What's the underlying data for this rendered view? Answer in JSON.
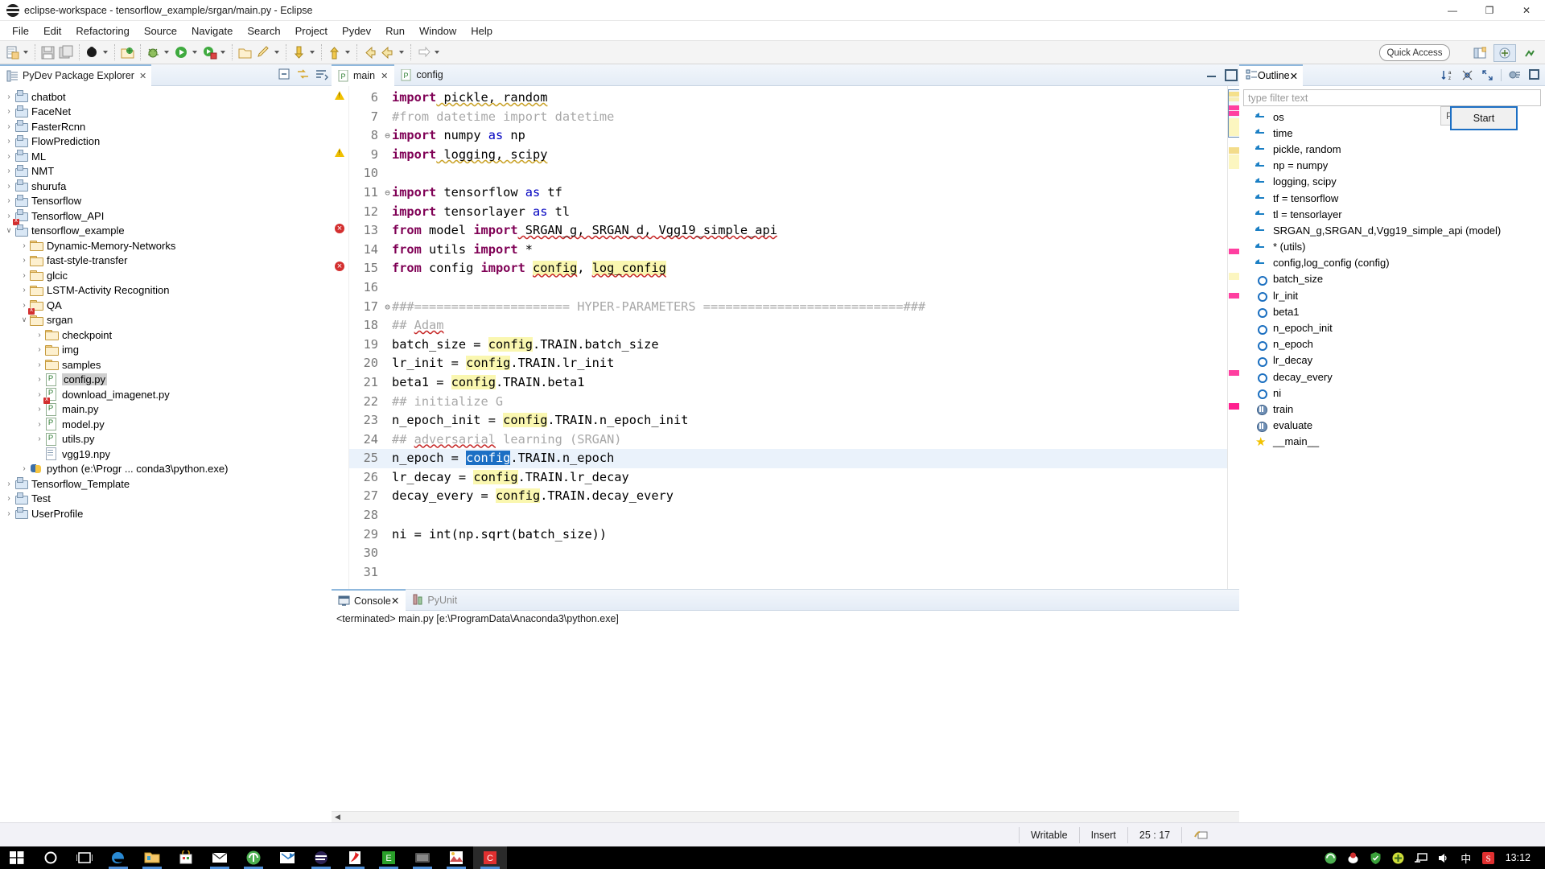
{
  "window": {
    "title": "eclipse-workspace - tensorflow_example/srgan/main.py - Eclipse",
    "minimize": "—",
    "maximize": "❐",
    "close": "✕"
  },
  "menubar": {
    "items": [
      "File",
      "Edit",
      "Refactoring",
      "Source",
      "Navigate",
      "Search",
      "Project",
      "Pydev",
      "Run",
      "Window",
      "Help"
    ]
  },
  "toolbar": {
    "quick_access": "Quick Access",
    "perspective_poi": "Poi...",
    "start_tooltip": "Start"
  },
  "package_explorer": {
    "tab_label": "PyDev Package Explorer",
    "tab_close": "✕",
    "tools": [
      "collapse-all-icon",
      "link-with-editor-icon",
      "view-menu-icon"
    ],
    "tree": [
      {
        "label": "chatbot",
        "indent": 0,
        "icon": "project-icon",
        "twist": "›"
      },
      {
        "label": "FaceNet",
        "indent": 0,
        "icon": "project-icon",
        "twist": "›"
      },
      {
        "label": "FasterRcnn",
        "indent": 0,
        "icon": "project-icon",
        "twist": "›"
      },
      {
        "label": "FlowPrediction",
        "indent": 0,
        "icon": "project-icon",
        "twist": "›"
      },
      {
        "label": "ML",
        "indent": 0,
        "icon": "project-icon",
        "twist": "›"
      },
      {
        "label": "NMT",
        "indent": 0,
        "icon": "project-icon",
        "twist": "›"
      },
      {
        "label": "shurufa",
        "indent": 0,
        "icon": "project-icon",
        "twist": "›"
      },
      {
        "label": "Tensorflow",
        "indent": 0,
        "icon": "project-icon",
        "twist": "›"
      },
      {
        "label": "Tensorflow_API",
        "indent": 0,
        "icon": "project-icon",
        "twist": "›"
      },
      {
        "label": "tensorflow_example",
        "indent": 0,
        "icon": "project-error-icon",
        "twist": "⌄"
      },
      {
        "label": "Dynamic-Memory-Networks",
        "indent": 1,
        "icon": "folder-icon",
        "twist": "›"
      },
      {
        "label": "fast-style-transfer",
        "indent": 1,
        "icon": "folder-icon",
        "twist": "›"
      },
      {
        "label": "glcic",
        "indent": 1,
        "icon": "folder-icon",
        "twist": "›"
      },
      {
        "label": "LSTM-Activity Recognition",
        "indent": 1,
        "icon": "folder-icon",
        "twist": "›"
      },
      {
        "label": "QA",
        "indent": 1,
        "icon": "folder-icon",
        "twist": "›"
      },
      {
        "label": "srgan",
        "indent": 1,
        "icon": "folder-error-icon",
        "twist": "⌄"
      },
      {
        "label": "checkpoint",
        "indent": 2,
        "icon": "folder-icon",
        "twist": "›"
      },
      {
        "label": "img",
        "indent": 2,
        "icon": "folder-icon",
        "twist": "›"
      },
      {
        "label": "samples",
        "indent": 2,
        "icon": "folder-icon",
        "twist": "›"
      },
      {
        "label": "config.py",
        "indent": 2,
        "icon": "python-file-icon",
        "twist": "›",
        "selected": true
      },
      {
        "label": "download_imagenet.py",
        "indent": 2,
        "icon": "python-file-icon",
        "twist": "›"
      },
      {
        "label": "main.py",
        "indent": 2,
        "icon": "python-file-error-icon",
        "twist": "›"
      },
      {
        "label": "model.py",
        "indent": 2,
        "icon": "python-file-icon",
        "twist": "›"
      },
      {
        "label": "utils.py",
        "indent": 2,
        "icon": "python-file-icon",
        "twist": "›"
      },
      {
        "label": "vgg19.npy",
        "indent": 2,
        "icon": "npy-file-icon",
        "twist": ""
      },
      {
        "label": "python  (e:\\Progr ... conda3\\python.exe)",
        "indent": 1,
        "icon": "python-interpreter-icon",
        "twist": "›"
      },
      {
        "label": "Tensorflow_Template",
        "indent": 0,
        "icon": "project-icon",
        "twist": "›"
      },
      {
        "label": "Test",
        "indent": 0,
        "icon": "project-icon",
        "twist": "›"
      },
      {
        "label": "UserProfile",
        "indent": 0,
        "icon": "project-icon",
        "twist": "›"
      }
    ]
  },
  "editor": {
    "tabs": [
      {
        "label": "main",
        "active": true,
        "close": "✕"
      },
      {
        "label": "config",
        "active": false,
        "close": ""
      }
    ],
    "lines": [
      {
        "no": "6",
        "marker": "warning",
        "fold": "",
        "segs": [
          {
            "t": "import",
            "c": "kw"
          },
          {
            "t": " pickle, random",
            "c": "sqy"
          }
        ]
      },
      {
        "no": "7",
        "marker": "",
        "fold": "",
        "segs": [
          {
            "t": "#from datetime import datetime",
            "c": "cm"
          }
        ]
      },
      {
        "no": "8",
        "marker": "",
        "fold": "⊖",
        "segs": [
          {
            "t": "import",
            "c": "kw"
          },
          {
            "t": " numpy ",
            "c": ""
          },
          {
            "t": "as",
            "c": "kw2"
          },
          {
            "t": " np",
            "c": ""
          }
        ]
      },
      {
        "no": "9",
        "marker": "warning",
        "fold": "",
        "segs": [
          {
            "t": "import",
            "c": "kw"
          },
          {
            "t": " logging, scipy",
            "c": "sqy"
          }
        ]
      },
      {
        "no": "10",
        "marker": "",
        "fold": "",
        "segs": []
      },
      {
        "no": "11",
        "marker": "",
        "fold": "⊖",
        "segs": [
          {
            "t": "import",
            "c": "kw"
          },
          {
            "t": " tensorflow ",
            "c": ""
          },
          {
            "t": "as",
            "c": "kw2"
          },
          {
            "t": " tf",
            "c": ""
          }
        ]
      },
      {
        "no": "12",
        "marker": "",
        "fold": "",
        "segs": [
          {
            "t": "import",
            "c": "kw"
          },
          {
            "t": " tensorlayer ",
            "c": ""
          },
          {
            "t": "as",
            "c": "kw2"
          },
          {
            "t": " tl",
            "c": ""
          }
        ]
      },
      {
        "no": "13",
        "marker": "error",
        "fold": "",
        "segs": [
          {
            "t": "from",
            "c": "kw"
          },
          {
            "t": " model ",
            "c": ""
          },
          {
            "t": "import",
            "c": "kw"
          },
          {
            "t": " SRGAN_g, SRGAN_d, Vgg19_simple_api",
            "c": "sqr"
          }
        ]
      },
      {
        "no": "14",
        "marker": "",
        "fold": "",
        "segs": [
          {
            "t": "from",
            "c": "kw"
          },
          {
            "t": " utils ",
            "c": ""
          },
          {
            "t": "import",
            "c": "kw"
          },
          {
            "t": " *",
            "c": ""
          }
        ]
      },
      {
        "no": "15",
        "marker": "error",
        "fold": "",
        "segs": [
          {
            "t": "from",
            "c": "kw"
          },
          {
            "t": " config ",
            "c": ""
          },
          {
            "t": "import",
            "c": "kw"
          },
          {
            "t": " ",
            "c": ""
          },
          {
            "t": "config",
            "c": "hl sqr"
          },
          {
            "t": ", ",
            "c": ""
          },
          {
            "t": "log_config",
            "c": "hl sqr"
          }
        ]
      },
      {
        "no": "16",
        "marker": "",
        "fold": "",
        "segs": []
      },
      {
        "no": "17",
        "marker": "",
        "fold": "⊖",
        "segs": [
          {
            "t": "###===================== HYPER-PARAMETERS ===========================###",
            "c": "cm"
          }
        ]
      },
      {
        "no": "18",
        "marker": "",
        "fold": "",
        "segs": [
          {
            "t": "## ",
            "c": "cm"
          },
          {
            "t": "Adam",
            "c": "cm sqr"
          }
        ]
      },
      {
        "no": "19",
        "marker": "",
        "fold": "",
        "segs": [
          {
            "t": "batch_size = ",
            "c": ""
          },
          {
            "t": "config",
            "c": "hl"
          },
          {
            "t": ".TRAIN.batch_size",
            "c": ""
          }
        ]
      },
      {
        "no": "20",
        "marker": "",
        "fold": "",
        "segs": [
          {
            "t": "lr_init = ",
            "c": ""
          },
          {
            "t": "config",
            "c": "hl"
          },
          {
            "t": ".TRAIN.lr_init",
            "c": ""
          }
        ]
      },
      {
        "no": "21",
        "marker": "",
        "fold": "",
        "segs": [
          {
            "t": "beta1 = ",
            "c": ""
          },
          {
            "t": "config",
            "c": "hl"
          },
          {
            "t": ".TRAIN.beta1",
            "c": ""
          }
        ]
      },
      {
        "no": "22",
        "marker": "",
        "fold": "",
        "segs": [
          {
            "t": "## initialize G",
            "c": "cm"
          }
        ]
      },
      {
        "no": "23",
        "marker": "",
        "fold": "",
        "segs": [
          {
            "t": "n_epoch_init = ",
            "c": ""
          },
          {
            "t": "config",
            "c": "hl"
          },
          {
            "t": ".TRAIN.n_epoch_init",
            "c": ""
          }
        ]
      },
      {
        "no": "24",
        "marker": "",
        "fold": "",
        "segs": [
          {
            "t": "## ",
            "c": "cm"
          },
          {
            "t": "adversarial",
            "c": "cm sqr"
          },
          {
            "t": " learning (SRGAN)",
            "c": "cm"
          }
        ]
      },
      {
        "no": "25",
        "marker": "",
        "fold": "",
        "current": true,
        "segs": [
          {
            "t": "n_epoch = ",
            "c": ""
          },
          {
            "t": "config",
            "c": "selhl"
          },
          {
            "t": ".TRAIN.n_epoch",
            "c": ""
          }
        ]
      },
      {
        "no": "26",
        "marker": "",
        "fold": "",
        "segs": [
          {
            "t": "lr_decay = ",
            "c": ""
          },
          {
            "t": "config",
            "c": "hl"
          },
          {
            "t": ".TRAIN.lr_decay",
            "c": ""
          }
        ]
      },
      {
        "no": "27",
        "marker": "",
        "fold": "",
        "segs": [
          {
            "t": "decay_every = ",
            "c": ""
          },
          {
            "t": "config",
            "c": "hl"
          },
          {
            "t": ".TRAIN.decay_every",
            "c": ""
          }
        ]
      },
      {
        "no": "28",
        "marker": "",
        "fold": "",
        "segs": []
      },
      {
        "no": "29",
        "marker": "",
        "fold": "",
        "segs": [
          {
            "t": "ni = int(np.sqrt(batch_size))",
            "c": ""
          }
        ]
      },
      {
        "no": "30",
        "marker": "",
        "fold": "",
        "segs": []
      },
      {
        "no": "31",
        "marker": "",
        "fold": "",
        "segs": []
      }
    ]
  },
  "console": {
    "tabs": [
      {
        "label": "Console",
        "active": true,
        "close": "✕"
      },
      {
        "label": "PyUnit",
        "active": false,
        "close": ""
      }
    ],
    "output": "<terminated> main.py [e:\\ProgramData\\Anaconda3\\python.exe]"
  },
  "outline": {
    "tab_label": "Outline",
    "tab_close": "✕",
    "filter_placeholder": "type filter text",
    "items": [
      {
        "label": "os",
        "icon": "import-icon"
      },
      {
        "label": "time",
        "icon": "import-icon"
      },
      {
        "label": "pickle, random",
        "icon": "import-icon"
      },
      {
        "label": "np = numpy",
        "icon": "import-icon"
      },
      {
        "label": "logging, scipy",
        "icon": "import-icon"
      },
      {
        "label": "tf = tensorflow",
        "icon": "import-icon"
      },
      {
        "label": "tl = tensorlayer",
        "icon": "import-icon"
      },
      {
        "label": "SRGAN_g,SRGAN_d,Vgg19_simple_api (model)",
        "icon": "import-icon"
      },
      {
        "label": "* (utils)",
        "icon": "import-icon"
      },
      {
        "label": "config,log_config (config)",
        "icon": "import-icon"
      },
      {
        "label": "batch_size",
        "icon": "field-icon"
      },
      {
        "label": "lr_init",
        "icon": "field-icon"
      },
      {
        "label": "beta1",
        "icon": "field-icon"
      },
      {
        "label": "n_epoch_init",
        "icon": "field-icon"
      },
      {
        "label": "n_epoch",
        "icon": "field-icon"
      },
      {
        "label": "lr_decay",
        "icon": "field-icon"
      },
      {
        "label": "decay_every",
        "icon": "field-icon"
      },
      {
        "label": "ni",
        "icon": "field-icon"
      },
      {
        "label": "train",
        "icon": "function-icon"
      },
      {
        "label": "evaluate",
        "icon": "function-icon"
      },
      {
        "label": "__main__",
        "icon": "main-star-icon"
      }
    ]
  },
  "statusbar": {
    "writable": "Writable",
    "insert": "Insert",
    "position": "25 : 17"
  },
  "taskbar": {
    "clock": "13:12",
    "ime": "中"
  }
}
